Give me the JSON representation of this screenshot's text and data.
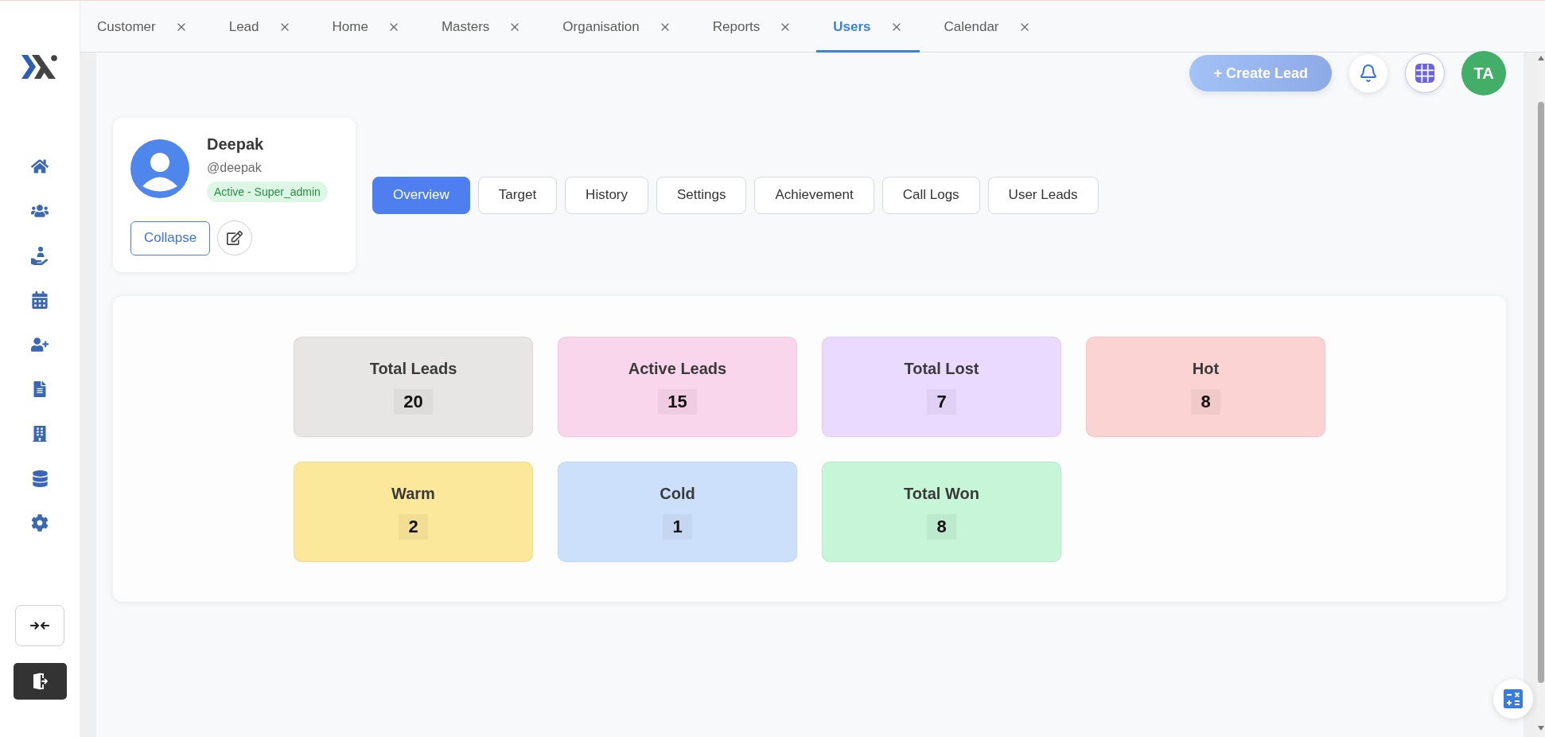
{
  "tabs": [
    {
      "label": "Customer",
      "selected": false
    },
    {
      "label": "Lead",
      "selected": false
    },
    {
      "label": "Home",
      "selected": false
    },
    {
      "label": "Masters",
      "selected": false
    },
    {
      "label": "Organisation",
      "selected": false
    },
    {
      "label": "Reports",
      "selected": false
    },
    {
      "label": "Users",
      "selected": true
    },
    {
      "label": "Calendar",
      "selected": false
    }
  ],
  "header": {
    "create_button": "+ Create Lead",
    "avatar_initials": "TA"
  },
  "profile": {
    "name": "Deepak",
    "handle": "@deepak",
    "status_badge": "Active - Super_admin",
    "collapse_button": "Collapse"
  },
  "profile_tabs": [
    {
      "label": "Overview",
      "selected": true
    },
    {
      "label": "Target",
      "selected": false
    },
    {
      "label": "History",
      "selected": false
    },
    {
      "label": "Settings",
      "selected": false
    },
    {
      "label": "Achievement",
      "selected": false
    },
    {
      "label": "Call Logs",
      "selected": false
    },
    {
      "label": "User Leads",
      "selected": false
    }
  ],
  "stats": [
    {
      "title": "Total Leads",
      "value": "20",
      "color": "#e8e6e4"
    },
    {
      "title": "Active Leads",
      "value": "15",
      "color": "#fad6ec"
    },
    {
      "title": "Total Lost",
      "value": "7",
      "color": "#eadaff"
    },
    {
      "title": "Hot",
      "value": "8",
      "color": "#fbd3d3"
    },
    {
      "title": "Warm",
      "value": "2",
      "color": "#fce89b"
    },
    {
      "title": "Cold",
      "value": "1",
      "color": "#cde0fb"
    },
    {
      "title": "Total Won",
      "value": "8",
      "color": "#c6f5d8"
    }
  ]
}
